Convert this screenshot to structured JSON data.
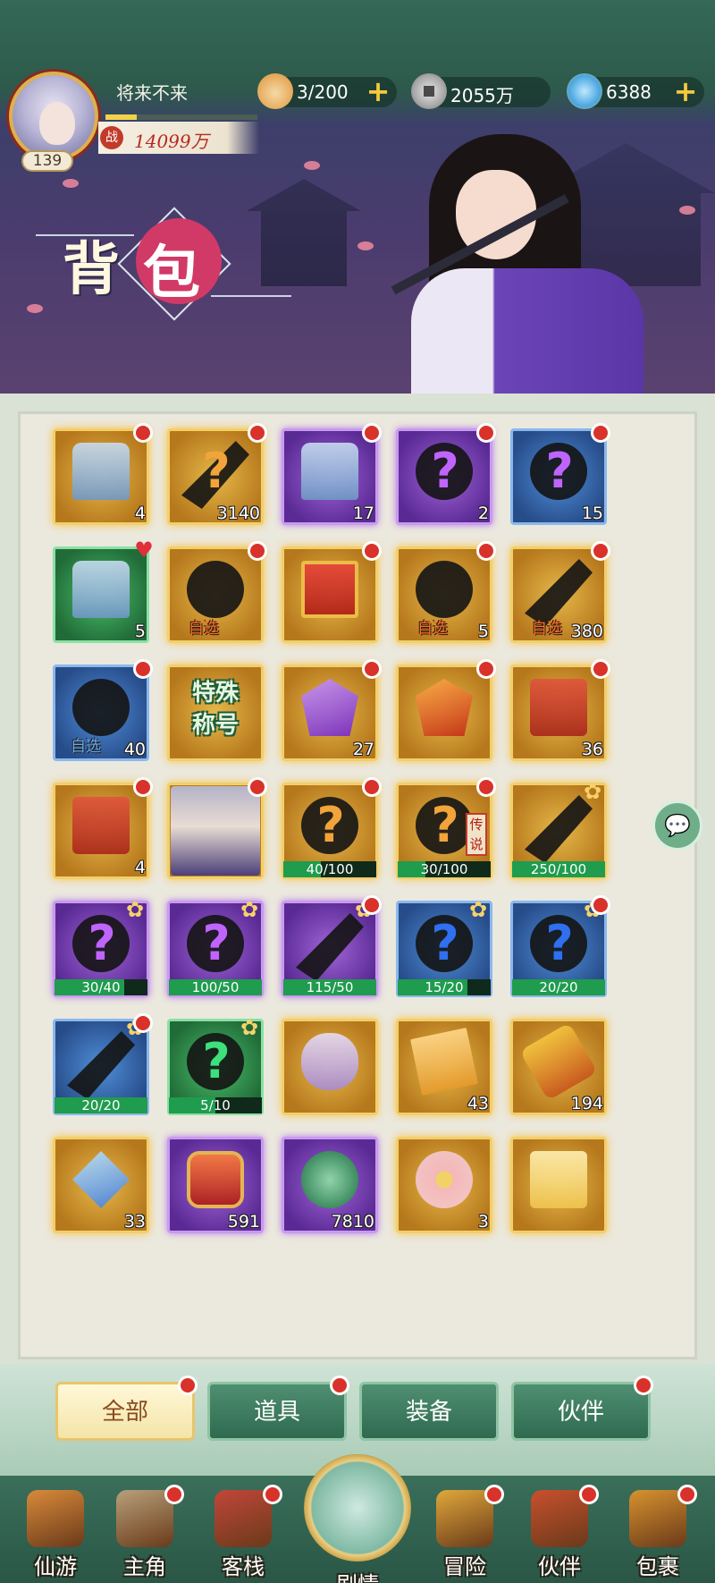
{
  "player": {
    "name": "将来不来",
    "level": "139",
    "power_icon": "战",
    "power": "14099万"
  },
  "resources": [
    {
      "name": "stamina",
      "icon": "bun-icon",
      "value": "3/200"
    },
    {
      "name": "coins",
      "icon": "coin-icon",
      "value": "2055万"
    },
    {
      "name": "jade",
      "icon": "jade-icon",
      "value": "6388"
    }
  ],
  "page_title": {
    "char1": "背",
    "char2": "包"
  },
  "items": [
    {
      "kind": "chest",
      "frame": "gold",
      "count": "4",
      "dot": true
    },
    {
      "kind": "mystery-bar",
      "frame": "gold",
      "qmark": "orange",
      "count": "3140",
      "dot": true
    },
    {
      "kind": "chest",
      "frame": "purple",
      "count": "17",
      "dot": true
    },
    {
      "kind": "mystery-bug",
      "frame": "purple",
      "qmark": "purple",
      "count": "2",
      "dot": true
    },
    {
      "kind": "mystery-bug",
      "frame": "blue",
      "qmark": "purple",
      "count": "15",
      "dot": true
    },
    {
      "kind": "treasure-box",
      "frame": "green",
      "count": "5",
      "heart": true
    },
    {
      "kind": "shadow",
      "frame": "gold",
      "select": "自选",
      "dot": true
    },
    {
      "kind": "gift",
      "frame": "gold",
      "dot": true
    },
    {
      "kind": "shadow",
      "frame": "gold",
      "select": "自选",
      "count": "5",
      "dot": true
    },
    {
      "kind": "mystery-bar",
      "frame": "gold",
      "select": "自选",
      "count": "380",
      "dot": true
    },
    {
      "kind": "shadow",
      "frame": "blue",
      "select": "自选",
      "select_color": "blue",
      "count": "40",
      "dot": true
    },
    {
      "kind": "special",
      "frame": "gold",
      "text_line1": "特殊",
      "text_line2": "称号"
    },
    {
      "kind": "gem-p",
      "frame": "gold",
      "count": "27",
      "dot": true
    },
    {
      "kind": "gem-r",
      "frame": "gold",
      "dot": true
    },
    {
      "kind": "redchest",
      "frame": "gold",
      "count": "36",
      "dot": true
    },
    {
      "kind": "redchest",
      "frame": "gold",
      "count": "4",
      "dot": true
    },
    {
      "kind": "portrait",
      "frame": "gold",
      "dot": true
    },
    {
      "kind": "shadow",
      "frame": "gold",
      "qmark": "orange",
      "progress": "40/100",
      "fill": 0.4,
      "dot": true
    },
    {
      "kind": "shadow",
      "frame": "gold",
      "qmark": "orange",
      "legend": "传说",
      "progress": "30/100",
      "fill": 0.3,
      "dot": true
    },
    {
      "kind": "bar",
      "frame": "gold",
      "spark": true,
      "progress": "250/100",
      "fill": 1.0
    },
    {
      "kind": "shadow",
      "frame": "purple",
      "qmark": "purple",
      "spark": true,
      "progress": "30/40",
      "fill": 0.75
    },
    {
      "kind": "mystery-bug",
      "frame": "purple",
      "qmark": "purple",
      "spark": true,
      "progress": "100/50",
      "fill": 1.0
    },
    {
      "kind": "bar",
      "frame": "purple",
      "spark": true,
      "progress": "115/50",
      "fill": 1.0,
      "dot": true
    },
    {
      "kind": "shadow",
      "frame": "blue",
      "qmark": "blue",
      "spark": true,
      "progress": "15/20",
      "fill": 0.75
    },
    {
      "kind": "mystery-bug",
      "frame": "blue",
      "qmark": "blue",
      "spark": true,
      "progress": "20/20",
      "fill": 1.0,
      "dot": true
    },
    {
      "kind": "bar",
      "frame": "blue",
      "spark": true,
      "progress": "20/20",
      "fill": 1.0,
      "dot": true
    },
    {
      "kind": "mystery-bug",
      "frame": "green",
      "qmark": "green",
      "spark": true,
      "progress": "5/10",
      "fill": 0.5
    },
    {
      "kind": "scroll",
      "frame": "gold"
    },
    {
      "kind": "talisman",
      "frame": "gold",
      "count": "43"
    },
    {
      "kind": "tube",
      "frame": "gold",
      "count": "194"
    },
    {
      "kind": "gem-b",
      "frame": "gold",
      "count": "33"
    },
    {
      "kind": "badge-r",
      "frame": "purple",
      "count": "591"
    },
    {
      "kind": "token",
      "frame": "purple",
      "count": "7810"
    },
    {
      "kind": "flower",
      "frame": "gold",
      "count": "3"
    },
    {
      "kind": "cake",
      "frame": "gold"
    }
  ],
  "tabs": [
    {
      "label": "全部",
      "active": true,
      "dot": true
    },
    {
      "label": "道具",
      "active": false,
      "dot": true
    },
    {
      "label": "装备",
      "active": false,
      "dot": false
    },
    {
      "label": "伙伴",
      "active": false,
      "dot": true
    }
  ],
  "nav": [
    {
      "label": "仙游",
      "icon": "book-icon",
      "dot": false,
      "color": "#d98a3a"
    },
    {
      "label": "主角",
      "icon": "hero-icon",
      "dot": true,
      "color": "#b7a07a"
    },
    {
      "label": "客栈",
      "icon": "inn-icon",
      "dot": true,
      "color": "#c2463a"
    },
    {
      "label": "剧情",
      "icon": "story-icon",
      "dot": false,
      "center": true
    },
    {
      "label": "冒险",
      "icon": "gourd-icon",
      "dot": true,
      "color": "#e0a83a"
    },
    {
      "label": "伙伴",
      "icon": "cards-icon",
      "dot": true,
      "color": "#c8502e"
    },
    {
      "label": "包裹",
      "icon": "bag-icon",
      "dot": true,
      "color": "#d7922e"
    }
  ]
}
